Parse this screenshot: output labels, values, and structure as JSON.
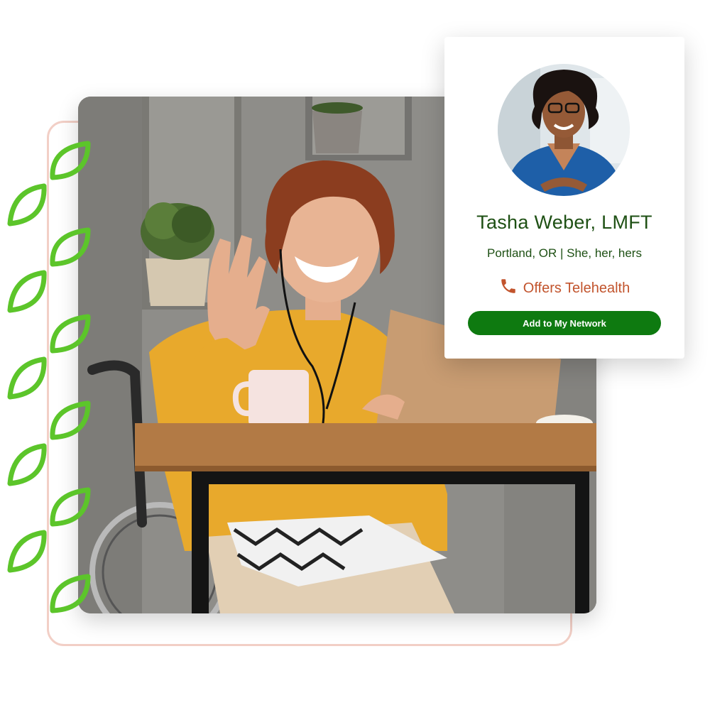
{
  "profile": {
    "name": "Tasha Weber, LMFT",
    "location_pronouns": "Portland, OR | She, her, hers",
    "telehealth_label": "Offers Telehealth",
    "add_button_label": "Add to My Network"
  },
  "icons": {
    "telehealth": "phone-icon",
    "decoration": "leaf-icon"
  },
  "colors": {
    "brand_green": "#0e7a10",
    "name_green": "#1e5014",
    "telehealth_orange": "#c2542d",
    "leaf_green": "#5cc52a",
    "frame_pink": "#f2cfc6"
  }
}
